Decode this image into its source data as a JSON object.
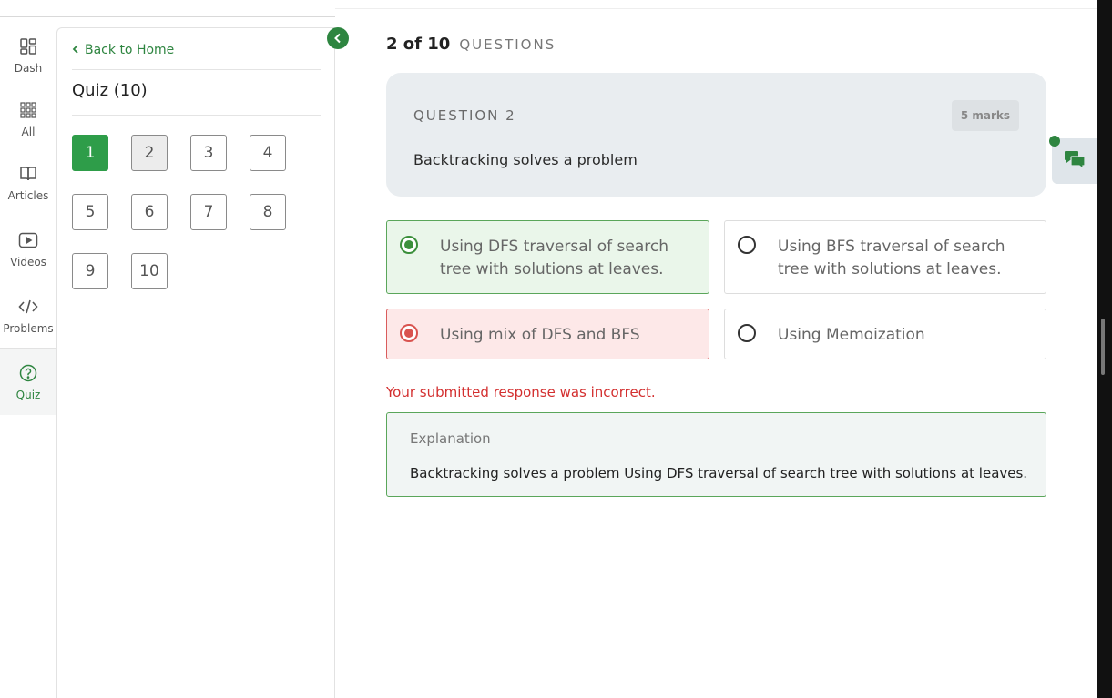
{
  "rail": {
    "items": [
      {
        "label": "Dash",
        "icon": "dashboard-icon"
      },
      {
        "label": "All",
        "icon": "grid-icon"
      },
      {
        "label": "Articles",
        "icon": "book-icon"
      },
      {
        "label": "Videos",
        "icon": "play-icon"
      },
      {
        "label": "Problems",
        "icon": "code-icon"
      },
      {
        "label": "Quiz",
        "icon": "question-icon"
      }
    ],
    "active": "Quiz"
  },
  "panel": {
    "back_label": "Back to Home",
    "title": "Quiz (10)",
    "questions": [
      "1",
      "2",
      "3",
      "4",
      "5",
      "6",
      "7",
      "8",
      "9",
      "10"
    ],
    "completed": [
      "1"
    ],
    "current": "2"
  },
  "progress": {
    "count": "2 of 10",
    "word": "QUESTIONS"
  },
  "question": {
    "label": "QUESTION 2",
    "marks": "5 marks",
    "text": "Backtracking solves a problem"
  },
  "options": [
    {
      "text": "Using DFS traversal of search tree with solutions at leaves.",
      "state": "correct"
    },
    {
      "text": "Using BFS traversal of search tree with solutions at leaves.",
      "state": "none"
    },
    {
      "text": "Using mix of DFS and BFS",
      "state": "wrong-selected"
    },
    {
      "text": "Using Memoization",
      "state": "none"
    }
  ],
  "result_message": "Your submitted response was incorrect.",
  "explanation": {
    "title": "Explanation",
    "text": "Backtracking solves a problem Using DFS traversal of search tree with solutions at leaves."
  },
  "colors": {
    "accent": "#2e8540",
    "correct": "#5aa65a",
    "wrong": "#d9534f"
  }
}
